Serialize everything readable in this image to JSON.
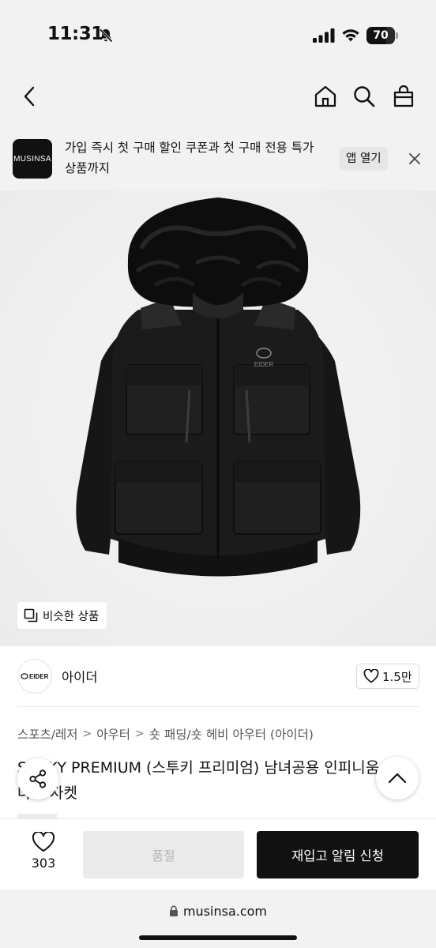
{
  "status_bar": {
    "time": "11:31",
    "battery_level": "70",
    "icons": [
      "bell-slash-icon",
      "signal-icon",
      "wifi-icon",
      "battery-icon"
    ]
  },
  "header": {
    "icons": [
      "back-chevron-icon",
      "home-icon",
      "search-icon",
      "shopping-bag-icon"
    ]
  },
  "banner": {
    "logo_text": "MUSINSA",
    "message": "가입 즉시 첫 구매 할인 쿠폰과 첫 구매 전용 특가 상품까지",
    "open_app_label": "앱 열기",
    "close_icon": "close-icon"
  },
  "product_image": {
    "similar_label": "비슷한 상품",
    "logo_text": "EIDER"
  },
  "brand": {
    "logo_text": "EIDER",
    "name": "아이더",
    "likes": "1.5만"
  },
  "breadcrumb": [
    "스포츠/레저",
    "아우터",
    "숏 패딩/숏 헤비 아우터 (아이더)"
  ],
  "product": {
    "title": "STOKY PREMIUM (스투키 프리미엄) 남녀공용 인피니움 다운 자켓"
  },
  "action_bar": {
    "wish_count": "303",
    "soldout_label": "품절",
    "restock_label": "재입고 알림 신청"
  },
  "browser": {
    "url": "musinsa.com"
  },
  "colors": {
    "background": "#f2f2f2",
    "primary_button": "#111111",
    "disabled_button": "#ebebeb"
  }
}
